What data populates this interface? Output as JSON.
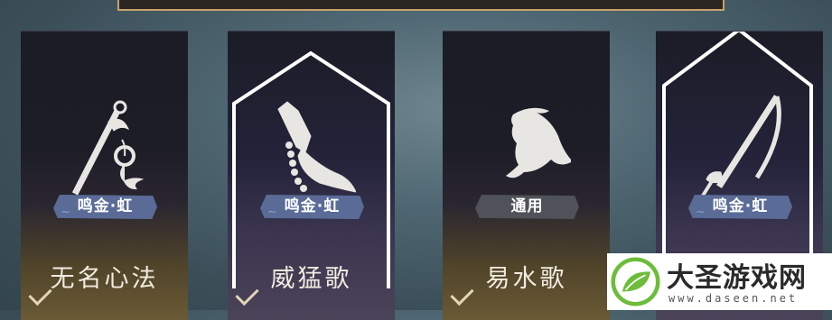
{
  "cards": [
    {
      "badge": "鸣金·虹",
      "name": "无名心法",
      "selected": false,
      "checked": true,
      "art": "sword-icon"
    },
    {
      "badge": "鸣金·虹",
      "name": "威猛歌",
      "selected": true,
      "checked": true,
      "art": "prayer-hands-icon"
    },
    {
      "badge": "通用",
      "name": "易水歌",
      "selected": false,
      "checked": true,
      "art": "horse-icon"
    },
    {
      "badge": "鸣金·虹",
      "name": "",
      "selected": true,
      "checked": false,
      "art": "spear-icon"
    }
  ],
  "watermark": {
    "title": "大圣游戏网",
    "url": "www.daseen.net"
  },
  "colors": {
    "badge_blue": "#5a6b97",
    "badge_grey": "#4f5258",
    "card_gold": "#6a5a35",
    "frame_white": "#ffffff"
  }
}
